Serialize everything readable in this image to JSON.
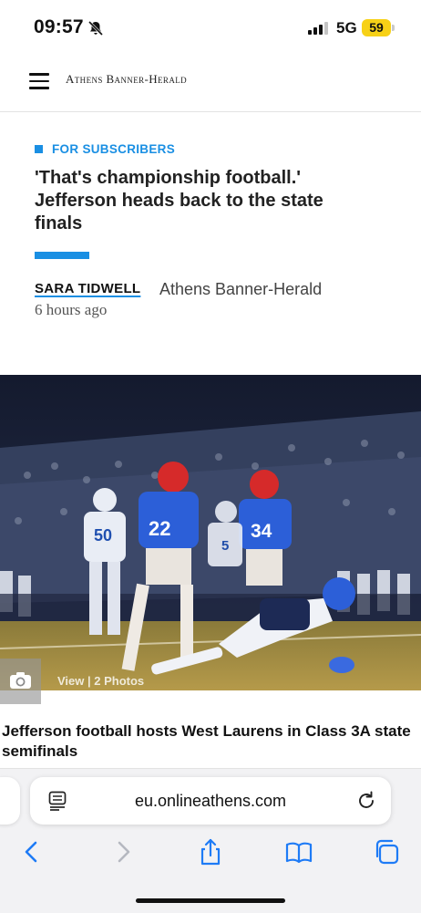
{
  "status": {
    "time": "09:57",
    "network": "5G",
    "battery": "59"
  },
  "site": {
    "logo": "Athens Banner-Herald"
  },
  "article": {
    "label": "FOR SUBSCRIBERS",
    "headline": "'That's championship football.' Jefferson heads back to the state finals",
    "author": "SARA TIDWELL",
    "publication": "Athens Banner-Herald",
    "time_ago": "6 hours ago",
    "photo_link": "View | 2 Photos",
    "caption": "Jefferson football hosts West Laurens in Class 3A state semifinals"
  },
  "browser": {
    "url": "eu.onlineathens.com"
  },
  "colors": {
    "accent": "#1a8fe3",
    "battery": "#f7d117",
    "toolbar_blue": "#1e7bf6"
  }
}
